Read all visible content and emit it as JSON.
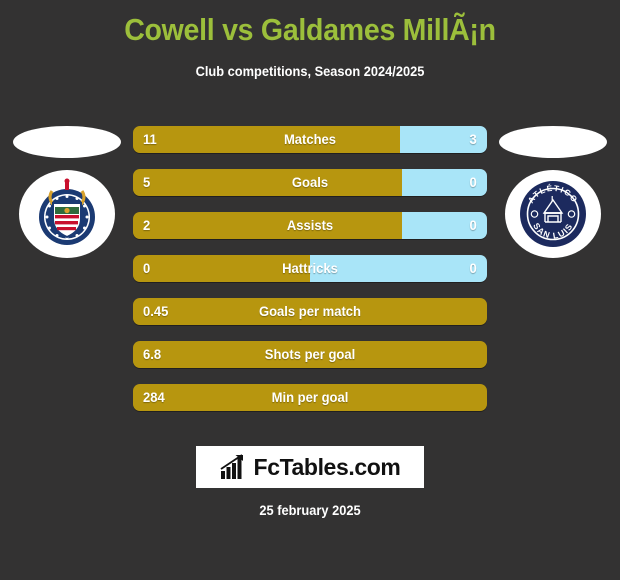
{
  "header": {
    "title": "Cowell vs Galdames MillÃ¡n",
    "subtitle": "Club competitions, Season 2024/2025",
    "title_color": "#9cbf3b"
  },
  "teams": {
    "home": {
      "crest_name": "chivas-guadalajara-crest",
      "crest_colors": [
        "#1b3a73",
        "#c8102e",
        "#ffffff",
        "#d7a12c"
      ]
    },
    "away": {
      "crest_name": "atletico-san-luis-crest",
      "crest_text_top": "ATLÉTICO",
      "crest_text_bottom": "SAN LUIS",
      "crest_colors": [
        "#1c2a5e",
        "#ffffff"
      ]
    }
  },
  "colors": {
    "background": "#333232",
    "bar_home": "#b7960f",
    "bar_away": "#a9e5f8",
    "text": "#ffffff"
  },
  "stats": [
    {
      "label": "Matches",
      "home": "11",
      "away": "3",
      "home_pct": 75.4,
      "has_away": true
    },
    {
      "label": "Goals",
      "home": "5",
      "away": "0",
      "home_pct": 76.0,
      "has_away": true
    },
    {
      "label": "Assists",
      "home": "2",
      "away": "0",
      "home_pct": 76.0,
      "has_away": true
    },
    {
      "label": "Hattricks",
      "home": "0",
      "away": "0",
      "home_pct": 50.0,
      "has_away": true
    },
    {
      "label": "Goals per match",
      "home": "0.45",
      "away": "",
      "home_pct": 100,
      "has_away": false
    },
    {
      "label": "Shots per goal",
      "home": "6.8",
      "away": "",
      "home_pct": 100,
      "has_away": false
    },
    {
      "label": "Min per goal",
      "home": "284",
      "away": "",
      "home_pct": 100,
      "has_away": false
    }
  ],
  "watermark": {
    "text": "FcTables.com",
    "icon_name": "bar-chart-growth-icon"
  },
  "footer": {
    "date": "25 february 2025"
  }
}
